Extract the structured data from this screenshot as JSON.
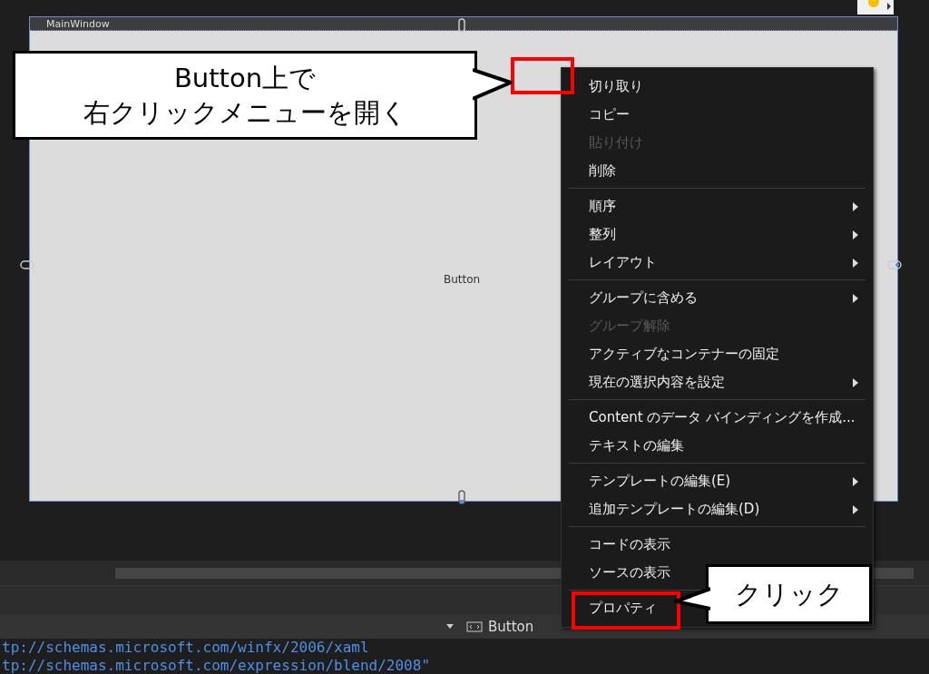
{
  "designer": {
    "window_title": "MainWindow",
    "button_label": "Button"
  },
  "context_menu": {
    "groups": [
      [
        {
          "label": "切り取り",
          "disabled": false,
          "submenu": false
        },
        {
          "label": "コピー",
          "disabled": false,
          "submenu": false
        },
        {
          "label": "貼り付け",
          "disabled": true,
          "submenu": false
        },
        {
          "label": "削除",
          "disabled": false,
          "submenu": false
        }
      ],
      [
        {
          "label": "順序",
          "disabled": false,
          "submenu": true
        },
        {
          "label": "整列",
          "disabled": false,
          "submenu": true
        },
        {
          "label": "レイアウト",
          "disabled": false,
          "submenu": true
        }
      ],
      [
        {
          "label": "グループに含める",
          "disabled": false,
          "submenu": true
        },
        {
          "label": "グループ解除",
          "disabled": true,
          "submenu": false
        },
        {
          "label": "アクティブなコンテナーの固定",
          "disabled": false,
          "submenu": false
        },
        {
          "label": "現在の選択内容を設定",
          "disabled": false,
          "submenu": true
        }
      ],
      [
        {
          "label": "Content のデータ バインディングを作成...",
          "disabled": false,
          "submenu": false
        },
        {
          "label": "テキストの編集",
          "disabled": false,
          "submenu": false
        }
      ],
      [
        {
          "label": "テンプレートの編集(E)",
          "disabled": false,
          "submenu": true
        },
        {
          "label": "追加テンプレートの編集(D)",
          "disabled": false,
          "submenu": true
        }
      ],
      [
        {
          "label": "コードの表示",
          "disabled": false,
          "submenu": false
        },
        {
          "label": "ソースの表示",
          "disabled": false
        }
      ],
      [
        {
          "label": "プロパティ",
          "disabled": false
        }
      ]
    ]
  },
  "callouts": [
    {
      "lines": [
        "Button上で",
        "右クリックメニューを開く"
      ]
    },
    {
      "lines": [
        "クリック"
      ]
    }
  ],
  "breadcrumb": {
    "element": "Button"
  },
  "code_lines": [
    "tp://schemas.microsoft.com/winfx/2006/xaml",
    "tp://schemas.microsoft.com/expression/blend/2008\""
  ]
}
